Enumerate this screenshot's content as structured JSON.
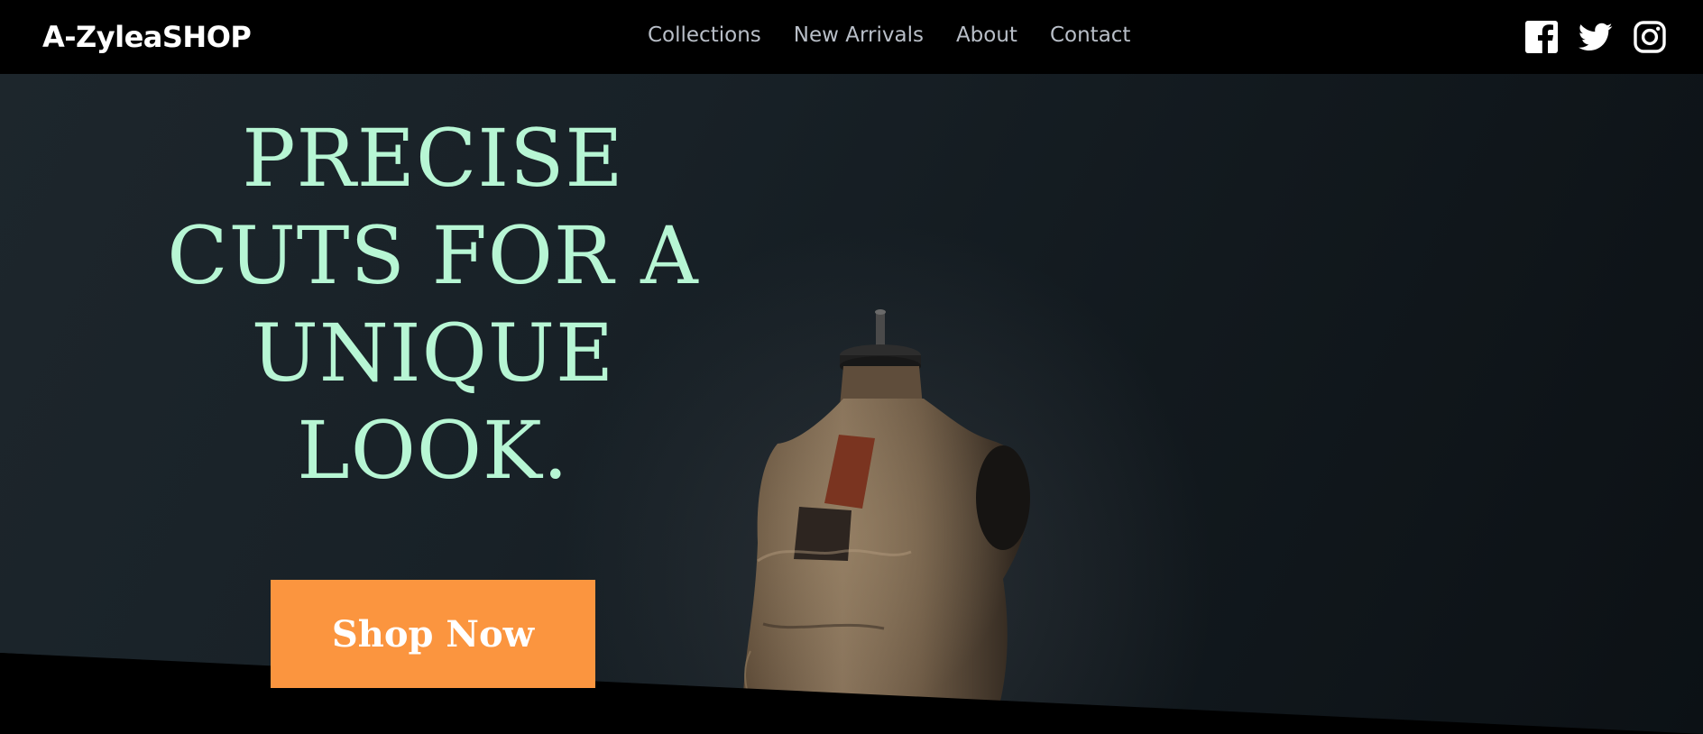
{
  "header": {
    "brand": "A-ZyleaSHOP",
    "nav": [
      {
        "label": "Collections"
      },
      {
        "label": "New Arrivals"
      },
      {
        "label": "About"
      },
      {
        "label": "Contact"
      }
    ],
    "social_icons": [
      "facebook-icon",
      "twitter-icon",
      "instagram-icon"
    ]
  },
  "hero": {
    "headline_lines": [
      "PRECISE",
      "CUTS FOR A",
      "UNIQUE",
      "LOOK."
    ],
    "cta_label": "Shop Now",
    "image": "dress-form-mannequin"
  },
  "colors": {
    "nav_background": "#000000",
    "brand_text": "#ffffff",
    "nav_link_text": "#b9bfc8",
    "headline": "#b7f6d4",
    "cta_background": "#fb953f",
    "cta_text": "#ffffff",
    "hero_background": "#182127"
  }
}
